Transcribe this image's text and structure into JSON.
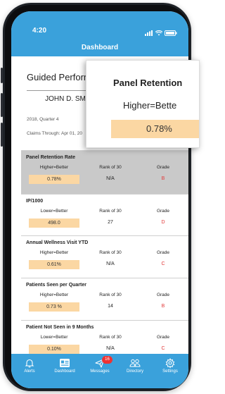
{
  "status": {
    "time": "4:20"
  },
  "app": {
    "title": "Dashboard"
  },
  "header": {
    "report_title": "Guided Performa",
    "provider_name": "JOHN D. SM",
    "period": "2018, Quarter 4",
    "claims": "Claims Through: Apr 01, 20"
  },
  "metrics": [
    {
      "title": "Panel Retention Rate",
      "col1": "Higher=Better",
      "col2": "Rank of 30",
      "col3": "Grade",
      "value": "0.78%",
      "rank": "N/A",
      "grade": "B"
    },
    {
      "title": "IP/1000",
      "col1": "Lower=Better",
      "col2": "Rank of 30",
      "col3": "Grade",
      "value": "498.0",
      "rank": "27",
      "grade": "D"
    },
    {
      "title": "Annual Wellness Visit YTD",
      "col1": "Higher=Better",
      "col2": "Rank of 30",
      "col3": "Grade",
      "value": "0.61%",
      "rank": "N/A",
      "grade": "C"
    },
    {
      "title": "Patients Seen per Quarter",
      "col1": "Higher=Better",
      "col2": "Rank of 30",
      "col3": "Grade",
      "value": "0.73 %",
      "rank": "14",
      "grade": "B"
    },
    {
      "title": "Patient Not Seen in 9 Months",
      "col1": "Lower=Better",
      "col2": "Rank of 30",
      "col3": "Grade",
      "value": "0.10%",
      "rank": "N/A",
      "grade": "C"
    }
  ],
  "popup": {
    "title": "Panel Retention",
    "subtitle": "Higher=Bette",
    "value": "0.78%"
  },
  "tabs": [
    {
      "label": "Alerts",
      "icon": "alerts-icon"
    },
    {
      "label": "Dashboard",
      "icon": "dashboard-icon"
    },
    {
      "label": "Messages",
      "icon": "messages-icon",
      "badge": "16"
    },
    {
      "label": "Directory",
      "icon": "directory-icon"
    },
    {
      "label": "Settings",
      "icon": "settings-icon"
    }
  ],
  "colors": {
    "accent": "#3aa1db",
    "highlight": "#fbd7a3",
    "grade": "#e23a3a"
  }
}
